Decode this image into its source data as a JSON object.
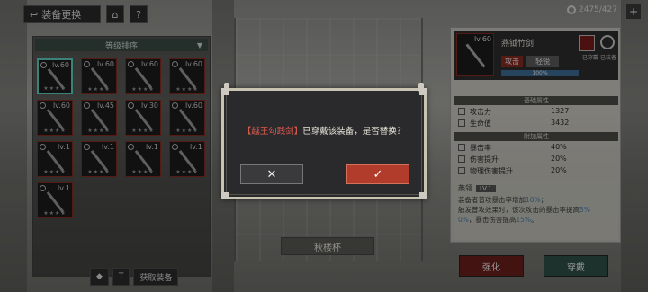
{
  "topbar": {
    "back_label": "装备更换",
    "home_icon": "home-icon",
    "help_label": "?"
  },
  "currency": {
    "amount": "2475/427",
    "plus": "+"
  },
  "left_panel": {
    "sort_label": "等级排序",
    "items": [
      {
        "level": "lv.60",
        "selected": true
      },
      {
        "level": "lv.60",
        "selected": false
      },
      {
        "level": "lv.60",
        "selected": false
      },
      {
        "level": "lv.60",
        "selected": false
      },
      {
        "level": "lv.60",
        "selected": false
      },
      {
        "level": "lv.45",
        "selected": false
      },
      {
        "level": "lv.30",
        "selected": false
      },
      {
        "level": "lv.60",
        "selected": false
      },
      {
        "level": "lv.1",
        "selected": false
      },
      {
        "level": "lv.1",
        "selected": false
      },
      {
        "level": "lv.1",
        "selected": false
      },
      {
        "level": "lv.1",
        "selected": false
      },
      {
        "level": "lv.1",
        "selected": false
      }
    ]
  },
  "bottom_bar": {
    "btn1": "◆",
    "btn2": "T",
    "btn3": "获取装备"
  },
  "center_label": "秋楼杯",
  "right_panel": {
    "level": "lv.60",
    "name": "燕钺竹剑",
    "row_key": "攻击",
    "row_value": "轻锐",
    "progress_text": "100%",
    "progress": 1.0,
    "avatar_label": "已穿戴",
    "gear_label": "已装备",
    "base_title": "基础属性",
    "base_stats": [
      {
        "name": "攻击力",
        "value": "1327"
      },
      {
        "name": "生命值",
        "value": "3432"
      }
    ],
    "extra_title": "附加属性",
    "extra_stats": [
      {
        "name": "暴击率",
        "value": "40%"
      },
      {
        "name": "伤害提升",
        "value": "20%"
      },
      {
        "name": "物理伤害提升",
        "value": "20%"
      }
    ],
    "skill_name": "燕翎",
    "skill_level": "LV.1",
    "skill_line1_a": "装备者普攻暴击率增加",
    "skill_line1_b": "10%",
    "skill_line1_c": "；",
    "skill_line2_a": "触发普攻效果时，该次攻击的暴击率提高",
    "skill_line2_b": "5%",
    "skill_line3_a": "0%",
    "skill_line3_b": "，暴击伤害提高",
    "skill_line3_c": "15%",
    "skill_line3_d": "。",
    "upgrade_label": "强化",
    "equip_label": "穿戴"
  },
  "modal": {
    "item_name": "【越王勾践剑】",
    "message": "已穿戴该装备，是否替换？",
    "cancel_label": "✕",
    "confirm_label": "✓"
  }
}
